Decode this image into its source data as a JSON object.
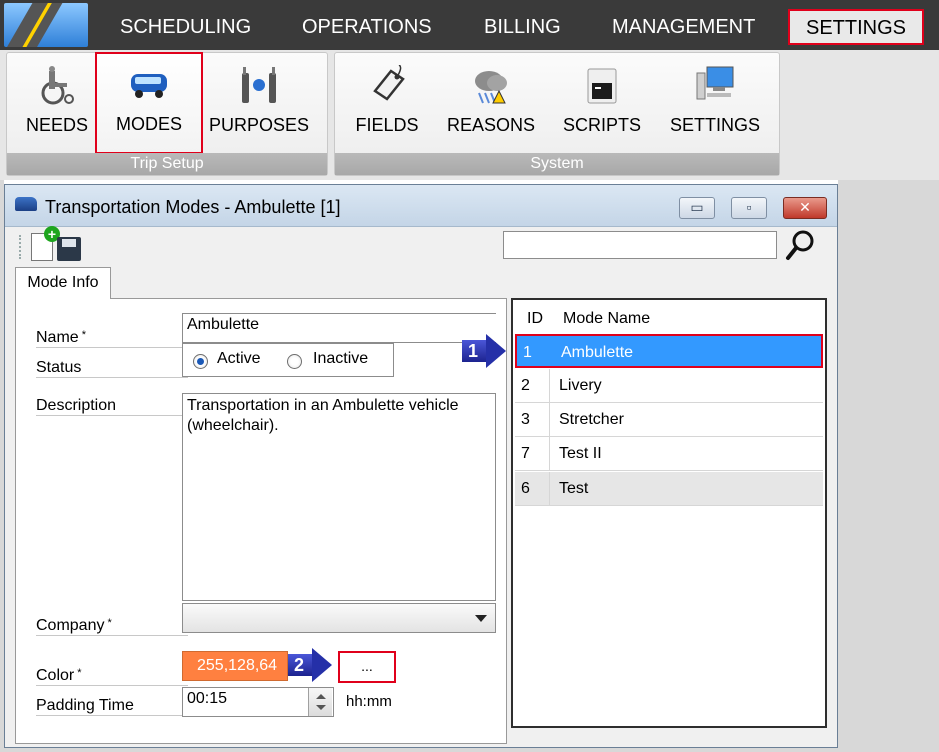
{
  "nav": {
    "tabs": [
      "SCHEDULING",
      "OPERATIONS",
      "BILLING",
      "MANAGEMENT",
      "SETTINGS"
    ],
    "active_tab": "SETTINGS"
  },
  "ribbon": {
    "groups": [
      {
        "label": "Trip Setup",
        "buttons": [
          "NEEDS",
          "MODES",
          "PURPOSES"
        ]
      },
      {
        "label": "System",
        "buttons": [
          "FIELDS",
          "REASONS",
          "SCRIPTS",
          "SETTINGS"
        ]
      }
    ],
    "selected_button": "MODES"
  },
  "window": {
    "title": "Transportation Modes - Ambulette [1]",
    "min_glyph": "▭",
    "max_glyph": "▫",
    "close_glyph": "✕"
  },
  "toolbar": {
    "search_value": ""
  },
  "tabs": [
    "Mode Info"
  ],
  "form": {
    "name_label": "Name",
    "name_value": "Ambulette",
    "status_label": "Status",
    "status_options": [
      "Active",
      "Inactive"
    ],
    "status_selected": "Active",
    "description_label": "Description",
    "description_value": "Transportation in an Ambulette vehicle\n(wheelchair).",
    "company_label": "Company",
    "company_value": "",
    "color_label": "Color",
    "color_value": "255,128,64",
    "color_hex": "#ff8040",
    "color_button": "...",
    "padding_label": "Padding Time",
    "padding_value": "00:15",
    "padding_unit": "hh:mm",
    "required_marker": "*"
  },
  "list": {
    "columns": [
      "ID",
      "Mode Name"
    ],
    "rows": [
      {
        "id": "1",
        "name": "Ambulette"
      },
      {
        "id": "2",
        "name": "Livery"
      },
      {
        "id": "3",
        "name": "Stretcher"
      },
      {
        "id": "7",
        "name": "Test II"
      },
      {
        "id": "6",
        "name": "Test"
      }
    ],
    "selected_id": "1"
  },
  "callouts": [
    "1",
    "2"
  ],
  "colors": {
    "accent_red": "#e0001b",
    "selection_blue": "#3399ff",
    "callout_blue": "#2530a8"
  }
}
